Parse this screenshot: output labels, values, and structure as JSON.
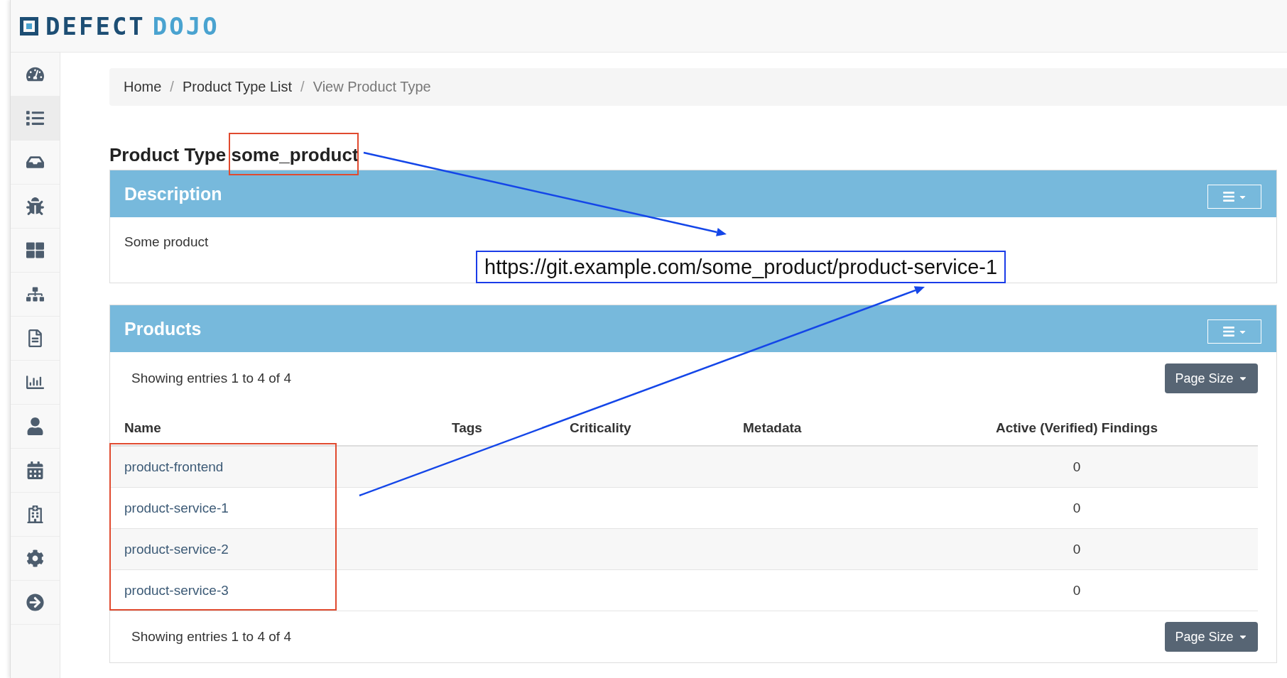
{
  "logo": {
    "word_1": "DEFECT",
    "word_2": "DOJO"
  },
  "sidebar": {
    "items": [
      {
        "kind": "dashboard",
        "selected": false
      },
      {
        "kind": "list",
        "selected": true
      },
      {
        "kind": "inbox",
        "selected": false
      },
      {
        "kind": "bug",
        "selected": false
      },
      {
        "kind": "grid",
        "selected": false
      },
      {
        "kind": "sitemap",
        "selected": false
      },
      {
        "kind": "document",
        "selected": false
      },
      {
        "kind": "chart",
        "selected": false
      },
      {
        "kind": "user",
        "selected": false
      },
      {
        "kind": "calendar",
        "selected": false
      },
      {
        "kind": "building",
        "selected": false
      },
      {
        "kind": "settings",
        "selected": false
      },
      {
        "kind": "logout",
        "selected": false
      }
    ]
  },
  "breadcrumb": [
    {
      "label": "Home",
      "active": false
    },
    {
      "separator": "/",
      "label": "Product Type List",
      "active": false
    },
    {
      "separator": "/",
      "label": "View Product Type",
      "active": true
    }
  ],
  "title": "Product Type some_product",
  "description_panel": {
    "heading": "Description",
    "text": "Some product"
  },
  "products_panel": {
    "heading": "Products",
    "entries_top": "Showing entries 1 to 4 of 4",
    "page_size_top": "Page Size",
    "columns": [
      "Name",
      "Tags",
      "Criticality",
      "Metadata",
      "Active (Verified) Findings"
    ],
    "rows": [
      {
        "name": "product-frontend",
        "findings": "0"
      },
      {
        "name": "product-service-1",
        "findings": "0"
      },
      {
        "name": "product-service-2",
        "findings": "0"
      },
      {
        "name": "product-service-3",
        "findings": "0"
      }
    ],
    "entries_bottom": "Showing entries 1 to 4 of 4",
    "page_size_bottom": "Page Size"
  },
  "annotation": {
    "url_label": "https://git.example.com/some_product/product-service-1"
  }
}
